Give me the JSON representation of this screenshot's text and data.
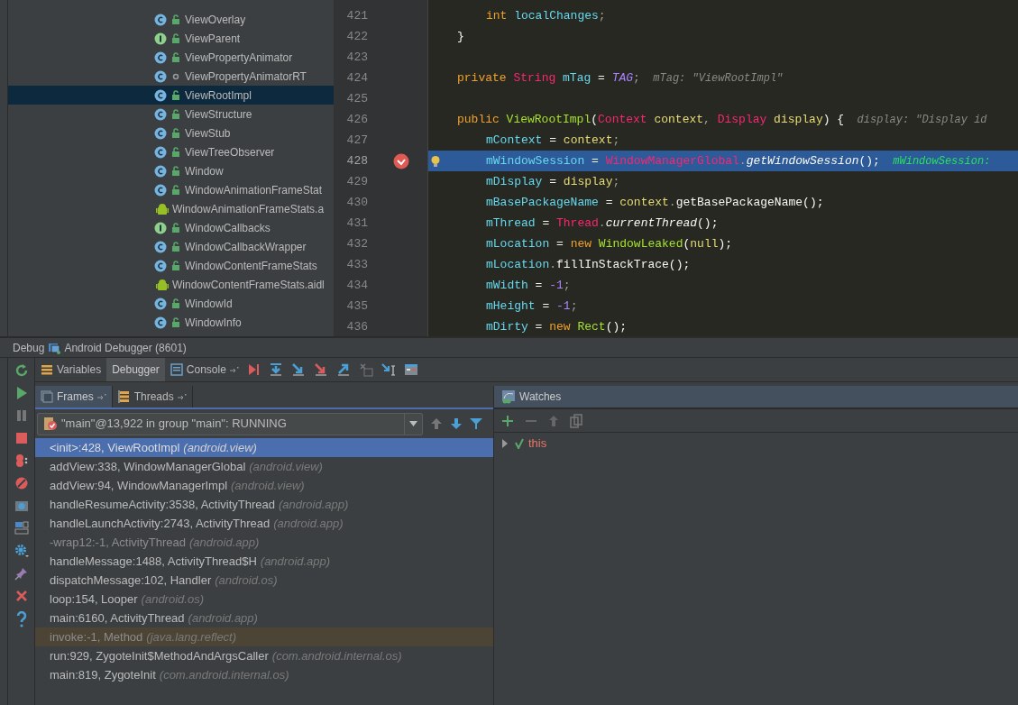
{
  "project_tree": [
    {
      "name": "ViewOverlay",
      "kind": "class",
      "selected": false
    },
    {
      "name": "ViewParent",
      "kind": "interface",
      "selected": false
    },
    {
      "name": "ViewPropertyAnimator",
      "kind": "class",
      "selected": false
    },
    {
      "name": "ViewPropertyAnimatorRT",
      "kind": "class-package",
      "selected": false
    },
    {
      "name": "ViewRootImpl",
      "kind": "class",
      "selected": true
    },
    {
      "name": "ViewStructure",
      "kind": "class",
      "selected": false
    },
    {
      "name": "ViewStub",
      "kind": "class",
      "selected": false
    },
    {
      "name": "ViewTreeObserver",
      "kind": "class",
      "selected": false
    },
    {
      "name": "Window",
      "kind": "class",
      "selected": false
    },
    {
      "name": "WindowAnimationFrameStat",
      "kind": "class",
      "selected": false
    },
    {
      "name": "WindowAnimationFrameStats.a",
      "kind": "aidl",
      "selected": false
    },
    {
      "name": "WindowCallbacks",
      "kind": "interface",
      "selected": false
    },
    {
      "name": "WindowCallbackWrapper",
      "kind": "class",
      "selected": false
    },
    {
      "name": "WindowContentFrameStats",
      "kind": "class",
      "selected": false
    },
    {
      "name": "WindowContentFrameStats.aidl",
      "kind": "aidl",
      "selected": false
    },
    {
      "name": "WindowId",
      "kind": "class",
      "selected": false
    },
    {
      "name": "WindowInfo",
      "kind": "class",
      "selected": false
    }
  ],
  "editor": {
    "lines": [
      {
        "children": [
          {
            "number": "421",
            "breakpoint": false,
            "current": false,
            "tokens": [
              {
                "text": "int",
                "kind": "keyword"
              },
              {
                "text": " localChanges",
                "kind": "field"
              },
              {
                "text": ";",
                "kind": "punct"
              }
            ]
          }
        ]
      },
      {
        "number": "422",
        "breakpoint": false,
        "current": false,
        "tokens": [
          {
            "text": "}",
            "kind": "plain"
          }
        ]
      },
      {
        "number": "423",
        "breakpoint": false,
        "current": false
      },
      {
        "number": "424",
        "breakpoint": false,
        "current": false,
        "tokens": [
          {
            "text": "private ",
            "kind": "keyword"
          },
          {
            "text": "String ",
            "kind": "type"
          },
          {
            "text": "mTag",
            "kind": "field"
          },
          {
            "text": " = ",
            "kind": "plain"
          },
          {
            "text": "TAG",
            "kind": "constant"
          },
          {
            "text": ";",
            "kind": "punct"
          },
          {
            "text": "  mTag: \"ViewRootImpl\"",
            "kind": "hint"
          }
        ]
      },
      {
        "number": "425",
        "breakpoint": false,
        "current": false
      },
      {
        "number": "426",
        "breakpoint": false,
        "current": false,
        "tokens": [
          {
            "text": "public ",
            "kind": "keyword"
          },
          {
            "text": "ViewRootImpl",
            "kind": "decl"
          },
          {
            "text": "(",
            "kind": "plain"
          },
          {
            "text": "Context ",
            "kind": "type"
          },
          {
            "text": "context",
            "kind": "param"
          },
          {
            "text": ", ",
            "kind": "punct"
          },
          {
            "text": "Display ",
            "kind": "type"
          },
          {
            "text": "display",
            "kind": "param"
          },
          {
            "text": ") {",
            "kind": "plain"
          },
          {
            "text": "  display: \"Display id",
            "kind": "hint"
          }
        ],
        "children": [
          {
            "number": "427",
            "breakpoint": false,
            "current": false,
            "tokens": [
              {
                "text": "mContext",
                "kind": "field"
              },
              {
                "text": " = ",
                "kind": "plain"
              },
              {
                "text": "context",
                "kind": "param"
              },
              {
                "text": ";",
                "kind": "punct"
              }
            ]
          },
          {
            "number": "428",
            "breakpoint": true,
            "current": true,
            "tokens": [
              {
                "text": "mWindowSession",
                "kind": "field"
              },
              {
                "text": " = ",
                "kind": "plain"
              },
              {
                "text": "WindowManagerGlobal",
                "kind": "type"
              },
              {
                "text": ".",
                "kind": "punct"
              },
              {
                "text": "getWindowSession",
                "kind": "static"
              },
              {
                "text": "();",
                "kind": "plain"
              },
              {
                "text": "  mWindowSession:",
                "kind": "value-hint"
              }
            ]
          },
          {
            "number": "429",
            "breakpoint": false,
            "current": false,
            "tokens": [
              {
                "text": "mDisplay",
                "kind": "field"
              },
              {
                "text": " = ",
                "kind": "plain"
              },
              {
                "text": "display",
                "kind": "param"
              },
              {
                "text": ";",
                "kind": "punct"
              }
            ]
          },
          {
            "number": "430",
            "breakpoint": false,
            "current": false,
            "tokens": [
              {
                "text": "mBasePackageName",
                "kind": "field"
              },
              {
                "text": " = ",
                "kind": "plain"
              },
              {
                "text": "context",
                "kind": "param"
              },
              {
                "text": ".",
                "kind": "punct"
              },
              {
                "text": "getBasePackageName",
                "kind": "plain"
              },
              {
                "text": "();",
                "kind": "plain"
              }
            ]
          },
          {
            "number": "431",
            "breakpoint": false,
            "current": false,
            "tokens": [
              {
                "text": "mThread",
                "kind": "field"
              },
              {
                "text": " = ",
                "kind": "plain"
              },
              {
                "text": "Thread",
                "kind": "type"
              },
              {
                "text": ".",
                "kind": "punct"
              },
              {
                "text": "currentThread",
                "kind": "static"
              },
              {
                "text": "();",
                "kind": "plain"
              }
            ]
          },
          {
            "number": "432",
            "breakpoint": false,
            "current": false,
            "tokens": [
              {
                "text": "mLocation",
                "kind": "field"
              },
              {
                "text": " = ",
                "kind": "plain"
              },
              {
                "text": "new ",
                "kind": "keyword"
              },
              {
                "text": "WindowLeaked",
                "kind": "decl"
              },
              {
                "text": "(",
                "kind": "plain"
              },
              {
                "text": "null",
                "kind": "param"
              },
              {
                "text": ");",
                "kind": "plain"
              }
            ]
          },
          {
            "number": "433",
            "breakpoint": false,
            "current": false,
            "tokens": [
              {
                "text": "mLocation",
                "kind": "field"
              },
              {
                "text": ".",
                "kind": "punct"
              },
              {
                "text": "fillInStackTrace",
                "kind": "plain"
              },
              {
                "text": "();",
                "kind": "plain"
              }
            ]
          },
          {
            "number": "434",
            "breakpoint": false,
            "current": false,
            "tokens": [
              {
                "text": "mWidth",
                "kind": "field"
              },
              {
                "text": " = ",
                "kind": "plain"
              },
              {
                "text": "-1",
                "kind": "number"
              },
              {
                "text": ";",
                "kind": "punct"
              }
            ]
          },
          {
            "number": "435",
            "breakpoint": false,
            "current": false,
            "tokens": [
              {
                "text": "mHeight",
                "kind": "field"
              },
              {
                "text": " = ",
                "kind": "plain"
              },
              {
                "text": "-1",
                "kind": "number"
              },
              {
                "text": ";",
                "kind": "punct"
              }
            ]
          },
          {
            "number": "436",
            "breakpoint": false,
            "current": false,
            "tokens": [
              {
                "text": "mDirty",
                "kind": "field"
              },
              {
                "text": " = ",
                "kind": "plain"
              },
              {
                "text": "new ",
                "kind": "keyword"
              },
              {
                "text": "Rect",
                "kind": "decl"
              },
              {
                "text": "();",
                "kind": "plain"
              }
            ]
          }
        ]
      }
    ]
  },
  "debug": {
    "title": "Debug",
    "session": "Android Debugger (8601)",
    "tabs": [
      {
        "label": "Variables",
        "kind": "variables",
        "selected": false
      },
      {
        "label": "Debugger",
        "kind": "plain",
        "selected": true
      },
      {
        "label": "Console",
        "kind": "console",
        "selected": false
      }
    ],
    "sub_tabs": [
      {
        "label": "Frames",
        "kind": "frames",
        "selected": true
      },
      {
        "label": "Threads",
        "kind": "threads",
        "selected": false
      }
    ],
    "thread": "\"main\"@13,922 in group \"main\": RUNNING",
    "frames": [
      {
        "location": "<init>:428, ViewRootImpl",
        "package": "(android.view)",
        "selected": true,
        "synthetic": false,
        "library": false
      },
      {
        "location": "addView:338, WindowManagerGlobal",
        "package": "(android.view)",
        "selected": false,
        "synthetic": false,
        "library": false
      },
      {
        "location": "addView:94, WindowManagerImpl",
        "package": "(android.view)",
        "selected": false,
        "synthetic": false,
        "library": false
      },
      {
        "location": "handleResumeActivity:3538, ActivityThread",
        "package": "(android.app)",
        "selected": false,
        "synthetic": false,
        "library": false
      },
      {
        "location": "handleLaunchActivity:2743, ActivityThread",
        "package": "(android.app)",
        "selected": false,
        "synthetic": false,
        "library": false
      },
      {
        "location": "-wrap12:-1, ActivityThread",
        "package": "(android.app)",
        "selected": false,
        "synthetic": true,
        "library": false
      },
      {
        "location": "handleMessage:1488, ActivityThread$H",
        "package": "(android.app)",
        "selected": false,
        "synthetic": false,
        "library": false
      },
      {
        "location": "dispatchMessage:102, Handler",
        "package": "(android.os)",
        "selected": false,
        "synthetic": false,
        "library": false
      },
      {
        "location": "loop:154, Looper",
        "package": "(android.os)",
        "selected": false,
        "synthetic": false,
        "library": false
      },
      {
        "location": "main:6160, ActivityThread",
        "package": "(android.app)",
        "selected": false,
        "synthetic": false,
        "library": false
      },
      {
        "location": "invoke:-1, Method",
        "package": "(java.lang.reflect)",
        "selected": false,
        "synthetic": true,
        "library": true
      },
      {
        "location": "run:929, ZygoteInit$MethodAndArgsCaller",
        "package": "(com.android.internal.os)",
        "selected": false,
        "synthetic": false,
        "library": false
      },
      {
        "location": "main:819, ZygoteInit",
        "package": "(com.android.internal.os)",
        "selected": false,
        "synthetic": false,
        "library": false
      }
    ],
    "watches": {
      "title": "Watches",
      "items": [
        {
          "name": "this",
          "expanded": false
        }
      ]
    }
  }
}
